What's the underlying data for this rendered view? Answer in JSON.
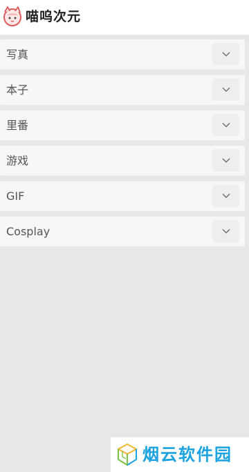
{
  "header": {
    "title": "喵呜次元",
    "logo_icon": "cat-face-icon"
  },
  "menu": {
    "items": [
      {
        "label": "写真",
        "icon": "chevron-down-icon"
      },
      {
        "label": "本子",
        "icon": "chevron-down-icon"
      },
      {
        "label": "里番",
        "icon": "chevron-down-icon"
      },
      {
        "label": "游戏",
        "icon": "chevron-down-icon"
      },
      {
        "label": "GIF",
        "icon": "chevron-down-icon"
      },
      {
        "label": "Cosplay",
        "icon": "chevron-down-icon"
      }
    ]
  },
  "watermark": {
    "text": "烟云软件园",
    "icon": "cube-logo-icon"
  },
  "colors": {
    "page_background": "#e8e8e8",
    "item_background": "#f7f7f7",
    "toggle_background": "#eeeeee",
    "label_text": "#555555",
    "logo_red": "#e05a5a",
    "watermark_blue": "#1aa3e0",
    "watermark_green": "#7cc242"
  }
}
